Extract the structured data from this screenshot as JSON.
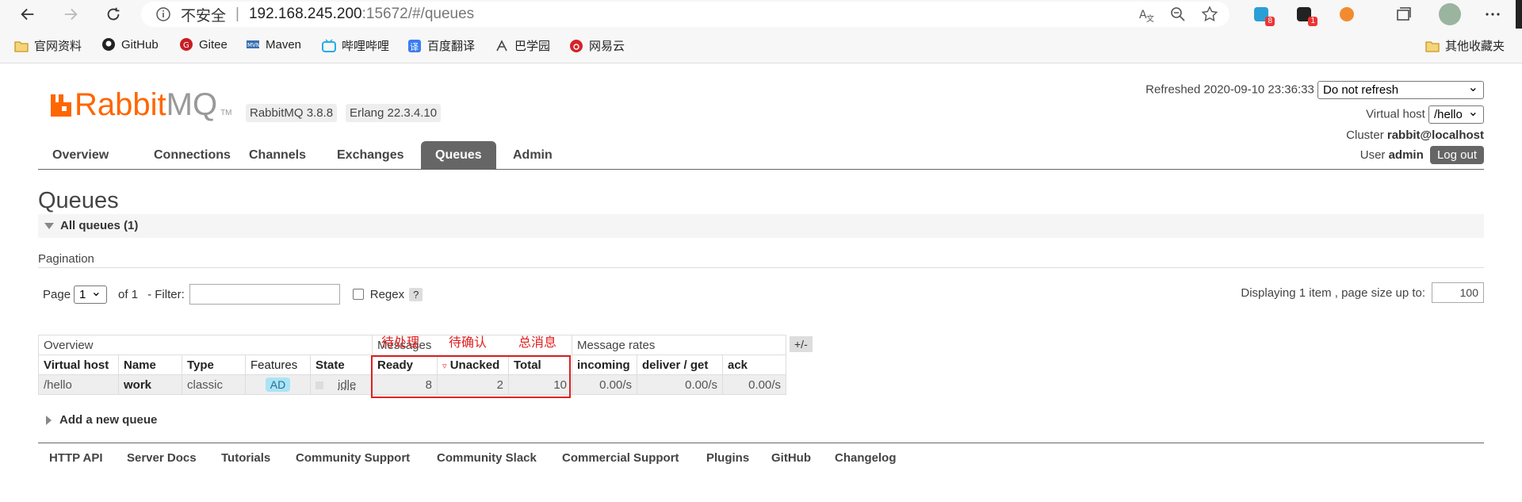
{
  "browser": {
    "address": {
      "insecure_label": "不安全",
      "separator": "|",
      "host": "192.168.245.200",
      "rest": ":15672/#/queues"
    },
    "extensions": [
      {
        "name": "extension-1",
        "badge": "8",
        "color": "#2a9fd6"
      },
      {
        "name": "extension-2",
        "badge": "1",
        "color": "#222222"
      },
      {
        "name": "extension-3",
        "badge": "",
        "color": "#f28b30"
      }
    ],
    "bookmarks": [
      {
        "label": "官网资料",
        "icon": "folder-icon",
        "color": "#e8b84a"
      },
      {
        "label": "GitHub",
        "icon": "github-icon",
        "color": "#222222"
      },
      {
        "label": "Gitee",
        "icon": "gitee-icon",
        "color": "#c71d23"
      },
      {
        "label": "Maven",
        "icon": "maven-icon",
        "color": "#3a6fb0"
      },
      {
        "label": "哔哩哔哩",
        "icon": "bilibili-icon",
        "color": "#23ade5"
      },
      {
        "label": "百度翻译",
        "icon": "baidu-translate-icon",
        "color": "#3a7df0"
      },
      {
        "label": "巴学园",
        "icon": "bxy-icon",
        "color": "#444444"
      },
      {
        "label": "网易云",
        "icon": "netease-music-icon",
        "color": "#d6232b"
      }
    ],
    "other_bookmarks": "其他收藏夹"
  },
  "app": {
    "logo_rabbit": "Rabbit",
    "logo_mq": "MQ",
    "logo_tm": "TM",
    "rabbitmq_version": "RabbitMQ 3.8.8",
    "erlang_version": "Erlang 22.3.4.10",
    "refreshed_label": "Refreshed 2020-09-10 23:36:33",
    "refresh_option": "Do not refresh",
    "vhost_label": "Virtual host",
    "vhost_value": "/hello",
    "cluster_label": "Cluster",
    "cluster_value": "rabbit@localhost",
    "user_label": "User",
    "user_value": "admin",
    "logout_label": "Log out",
    "accent_color": "#ff6600"
  },
  "tabs": [
    "Overview",
    "Connections",
    "Channels",
    "Exchanges",
    "Queues",
    "Admin"
  ],
  "active_tab": "Queues",
  "page": {
    "title": "Queues",
    "section_label": "All queues (1)",
    "pagination_label": "Pagination",
    "page_label": "Page",
    "page_value": "1",
    "of_label": "of 1",
    "filter_label": "- Filter:",
    "regex_label": "Regex",
    "help_label": "?",
    "displaying_label": "Displaying 1 item , page size up to:",
    "page_size": "100"
  },
  "table": {
    "group_overview": "Overview",
    "group_messages": "Messages",
    "group_rates": "Message rates",
    "plus_minus": "+/-",
    "headers": [
      "Virtual host",
      "Name",
      "Type",
      "Features",
      "State",
      "Ready",
      "Unacked",
      "Total",
      "incoming",
      "deliver / get",
      "ack"
    ],
    "unacked_marker": "▿",
    "row": {
      "vhost": "/hello",
      "name": "work",
      "type": "classic",
      "features": "AD",
      "state": "idle",
      "ready": "8",
      "unacked": "2",
      "total": "10",
      "incoming": "0.00/s",
      "deliver_get": "0.00/s",
      "ack": "0.00/s"
    }
  },
  "annotations": {
    "ready": "待处理",
    "unacked": "待确认",
    "total": "总消息"
  },
  "add_queue_label": "Add a new queue",
  "footer_links": [
    "HTTP API",
    "Server Docs",
    "Tutorials",
    "Community Support",
    "Community Slack",
    "Commercial Support",
    "Plugins",
    "GitHub",
    "Changelog"
  ]
}
